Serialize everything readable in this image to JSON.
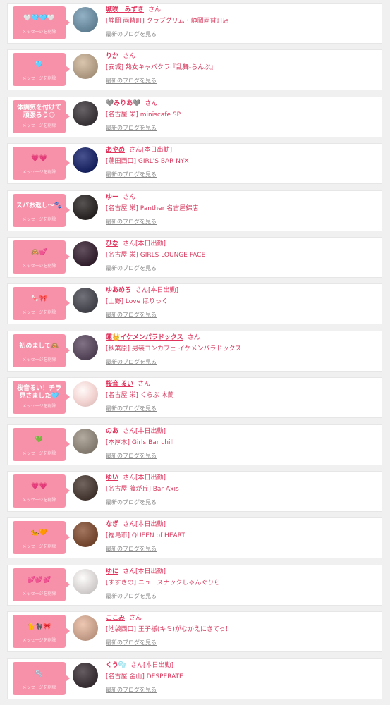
{
  "list": {
    "items": [
      {
        "message": "🤍🩵🩵🤍",
        "message_note": "メッセージを削除",
        "name": "城咲　みずき",
        "honorific": "さん",
        "status": "",
        "shop": "[静岡 両替町] クラブグリム・静岡両替町店",
        "blog_link": "最新のブログを見る",
        "avatar_color": "#6b8a9e"
      },
      {
        "message": "🩵",
        "message_note": "メッセージを削除",
        "name": "りか",
        "honorific": "さん",
        "status": "",
        "shop": "[安城] 熟女キャバクラ『乱舞-らんぶ』",
        "blog_link": "最新のブログを見る",
        "avatar_color": "#b29d86"
      },
      {
        "message": "体調気を付けて頑張ろう☺︎",
        "message_note": "メッセージを削除",
        "name": "🩶みりあ🩶",
        "honorific": "さん",
        "status": "",
        "shop": "[名古屋 栄] miniscafe SP",
        "blog_link": "最新のブログを見る",
        "avatar_color": "#3e3a3e"
      },
      {
        "message": "💗💗",
        "message_note": "メッセージを削除",
        "name": "あやめ",
        "honorific": "さん",
        "status": "[本日出勤]",
        "shop": "[蒲田西口] GIRL'S BAR NYX",
        "blog_link": "最新のブログを見る",
        "avatar_color": "#1f2a66"
      },
      {
        "message": "スパお返し〜🐾",
        "message_note": "メッセージを削除",
        "name": "ゆー",
        "honorific": "さん",
        "status": "",
        "shop": "[名古屋 栄] Panther 名古屋錦店",
        "blog_link": "最新のブログを見る",
        "avatar_color": "#2f2b2a"
      },
      {
        "message": "🙈💕",
        "message_note": "メッセージを削除",
        "name": "ひな",
        "honorific": "さん",
        "status": "[本日出勤]",
        "shop": "[名古屋 栄] GIRLS LOUNGE FACE",
        "blog_link": "最新のブログを見る",
        "avatar_color": "#3a2836"
      },
      {
        "message": "🍬🎀",
        "message_note": "メッセージを削除",
        "name": "ゆあめろ",
        "honorific": "さん",
        "status": "[本日出勤]",
        "shop": "[上野] Love ほりっく",
        "blog_link": "最新のブログを見る",
        "avatar_color": "#4a4a52"
      },
      {
        "message": "初めまして🙈",
        "message_note": "メッセージを削除",
        "name": "蓮👑イケメンパラドックス",
        "honorific": "さん",
        "status": "",
        "shop": "[秋葉原] 男装コンカフェ イケメンパラドックス",
        "blog_link": "最新のブログを見る",
        "avatar_color": "#5a4a5e"
      },
      {
        "message": "桜音るい！チラ見さました🩵",
        "message_note": "メッセージを削除",
        "name": "桜音 るい",
        "honorific": "さん",
        "status": "",
        "shop": "[名古屋 栄] くらぶ 木蘭",
        "blog_link": "最新のブログを見る",
        "avatar_color": "#f1d2d0"
      },
      {
        "message": "💚",
        "message_note": "メッセージを削除",
        "name": "のあ",
        "honorific": "さん",
        "status": "[本日出勤]",
        "shop": "[本厚木] Girls Bar chill",
        "blog_link": "最新のブログを見る",
        "avatar_color": "#8c8378"
      },
      {
        "message": "💗💗",
        "message_note": "メッセージを削除",
        "name": "ゆい",
        "honorific": "さん",
        "status": "[本日出勤]",
        "shop": "[名古屋 藤が丘] Bar Axis",
        "blog_link": "最新のブログを見る",
        "avatar_color": "#4a3c36"
      },
      {
        "message": "🐆🧡",
        "message_note": "メッセージを削除",
        "name": "なぎ",
        "honorific": "さん",
        "status": "[本日出勤]",
        "shop": "[福島市] QUEEN of HEART",
        "blog_link": "最新のブログを見る",
        "avatar_color": "#7a4e36"
      },
      {
        "message": "💕💕💕",
        "message_note": "メッセージを削除",
        "name": "ゆに",
        "honorific": "さん",
        "status": "[本日出勤]",
        "shop": "[すすきの] ニュースナックしゃんぐりら",
        "blog_link": "最新のブログを見る",
        "avatar_color": "#d8d4d4"
      },
      {
        "message": "🐈🐈‍⬛🎀",
        "message_note": "メッセージを削除",
        "name": "ここみ",
        "honorific": "さん",
        "status": "",
        "shop": "[池袋西口] 王子様(キミ)がむかえにきてっ！",
        "blog_link": "最新のブログを見る",
        "avatar_color": "#c7a08c"
      },
      {
        "message": "🫧",
        "message_note": "メッセージを削除",
        "name": "くう🫧",
        "honorific": "さん",
        "status": "[本日出勤]",
        "shop": "[名古屋 金山] DESPERATE",
        "blog_link": "最新のブログを見る",
        "avatar_color": "#3c3438"
      }
    ]
  }
}
